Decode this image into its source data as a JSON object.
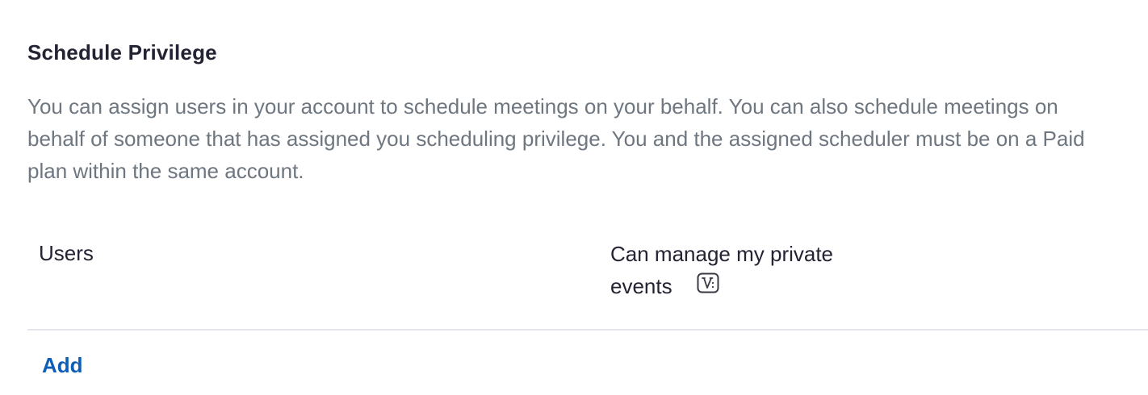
{
  "section": {
    "title": "Schedule Privilege",
    "description": "You can assign users in your account to schedule meetings on your behalf. You can also schedule meetings on behalf of someone that has assigned you scheduling privilege. You and the assigned scheduler must be on a Paid plan within the same account."
  },
  "table": {
    "columns": {
      "users": "Users",
      "private_events": "Can manage my private events"
    },
    "private_events_icon": "vip-badge-icon"
  },
  "actions": {
    "add_label": "Add"
  },
  "colors": {
    "title": "#232333",
    "description": "#6e7680",
    "link": "#0e5eb7",
    "divider": "#e4e5e8"
  }
}
